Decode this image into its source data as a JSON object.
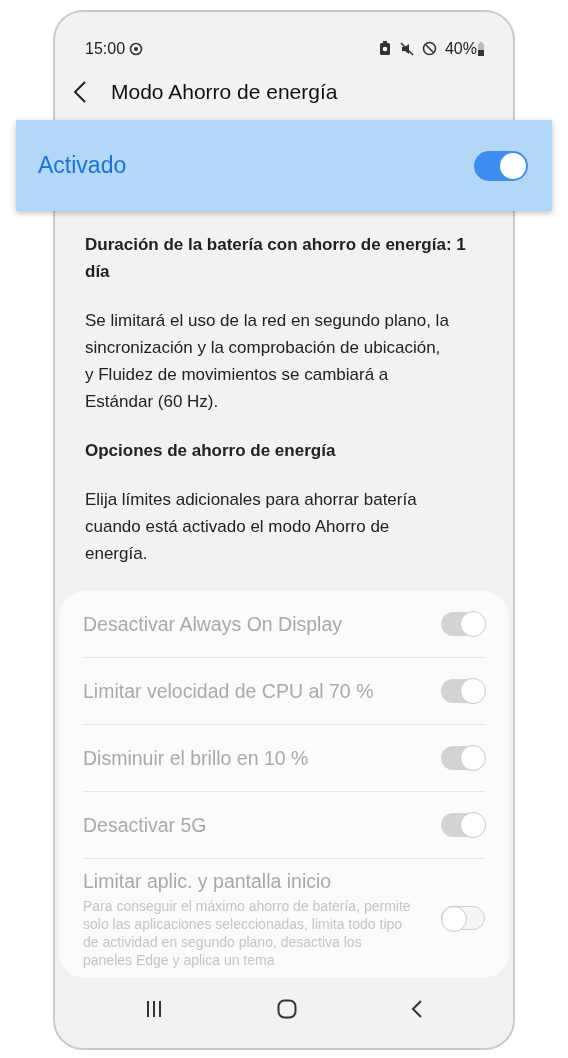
{
  "status_bar": {
    "time": "15:00",
    "battery": "40%"
  },
  "header": {
    "title": "Modo Ahorro de energía"
  },
  "master": {
    "label": "Activado",
    "checked": true
  },
  "sections": [
    {
      "kind": "heading",
      "text": "Duración de la batería con ahorro de energía: 1 día"
    },
    {
      "kind": "paragraph",
      "text": "Se limitará el uso de la red en segundo plano, la sincronización y la comprobación de ubicación, y Fluidez de movimientos se cambiará a Estándar (60 Hz)."
    },
    {
      "kind": "heading",
      "text": "Opciones de ahorro de energía"
    },
    {
      "kind": "paragraph",
      "text": "Elija límites adicionales para ahorrar batería cuando está activado el modo Ahorro de energía."
    }
  ],
  "options": [
    {
      "label": "Desactivar Always On Display",
      "checked": true,
      "disabled": true
    },
    {
      "label": "Limitar velocidad de CPU al 70 %",
      "checked": true,
      "disabled": true
    },
    {
      "label": "Disminuir el brillo en 10 %",
      "checked": true,
      "disabled": true
    },
    {
      "label": "Desactivar 5G",
      "checked": true,
      "disabled": true
    },
    {
      "label": "Limitar aplic. y pantalla inicio",
      "description": "Para conseguir el máximo ahorro de batería, permite solo las aplicaciones seleccionadas, limita todo tipo de actividad en segundo plano, desactiva los paneles Edge y aplica un tema",
      "checked": false,
      "disabled": true
    }
  ]
}
